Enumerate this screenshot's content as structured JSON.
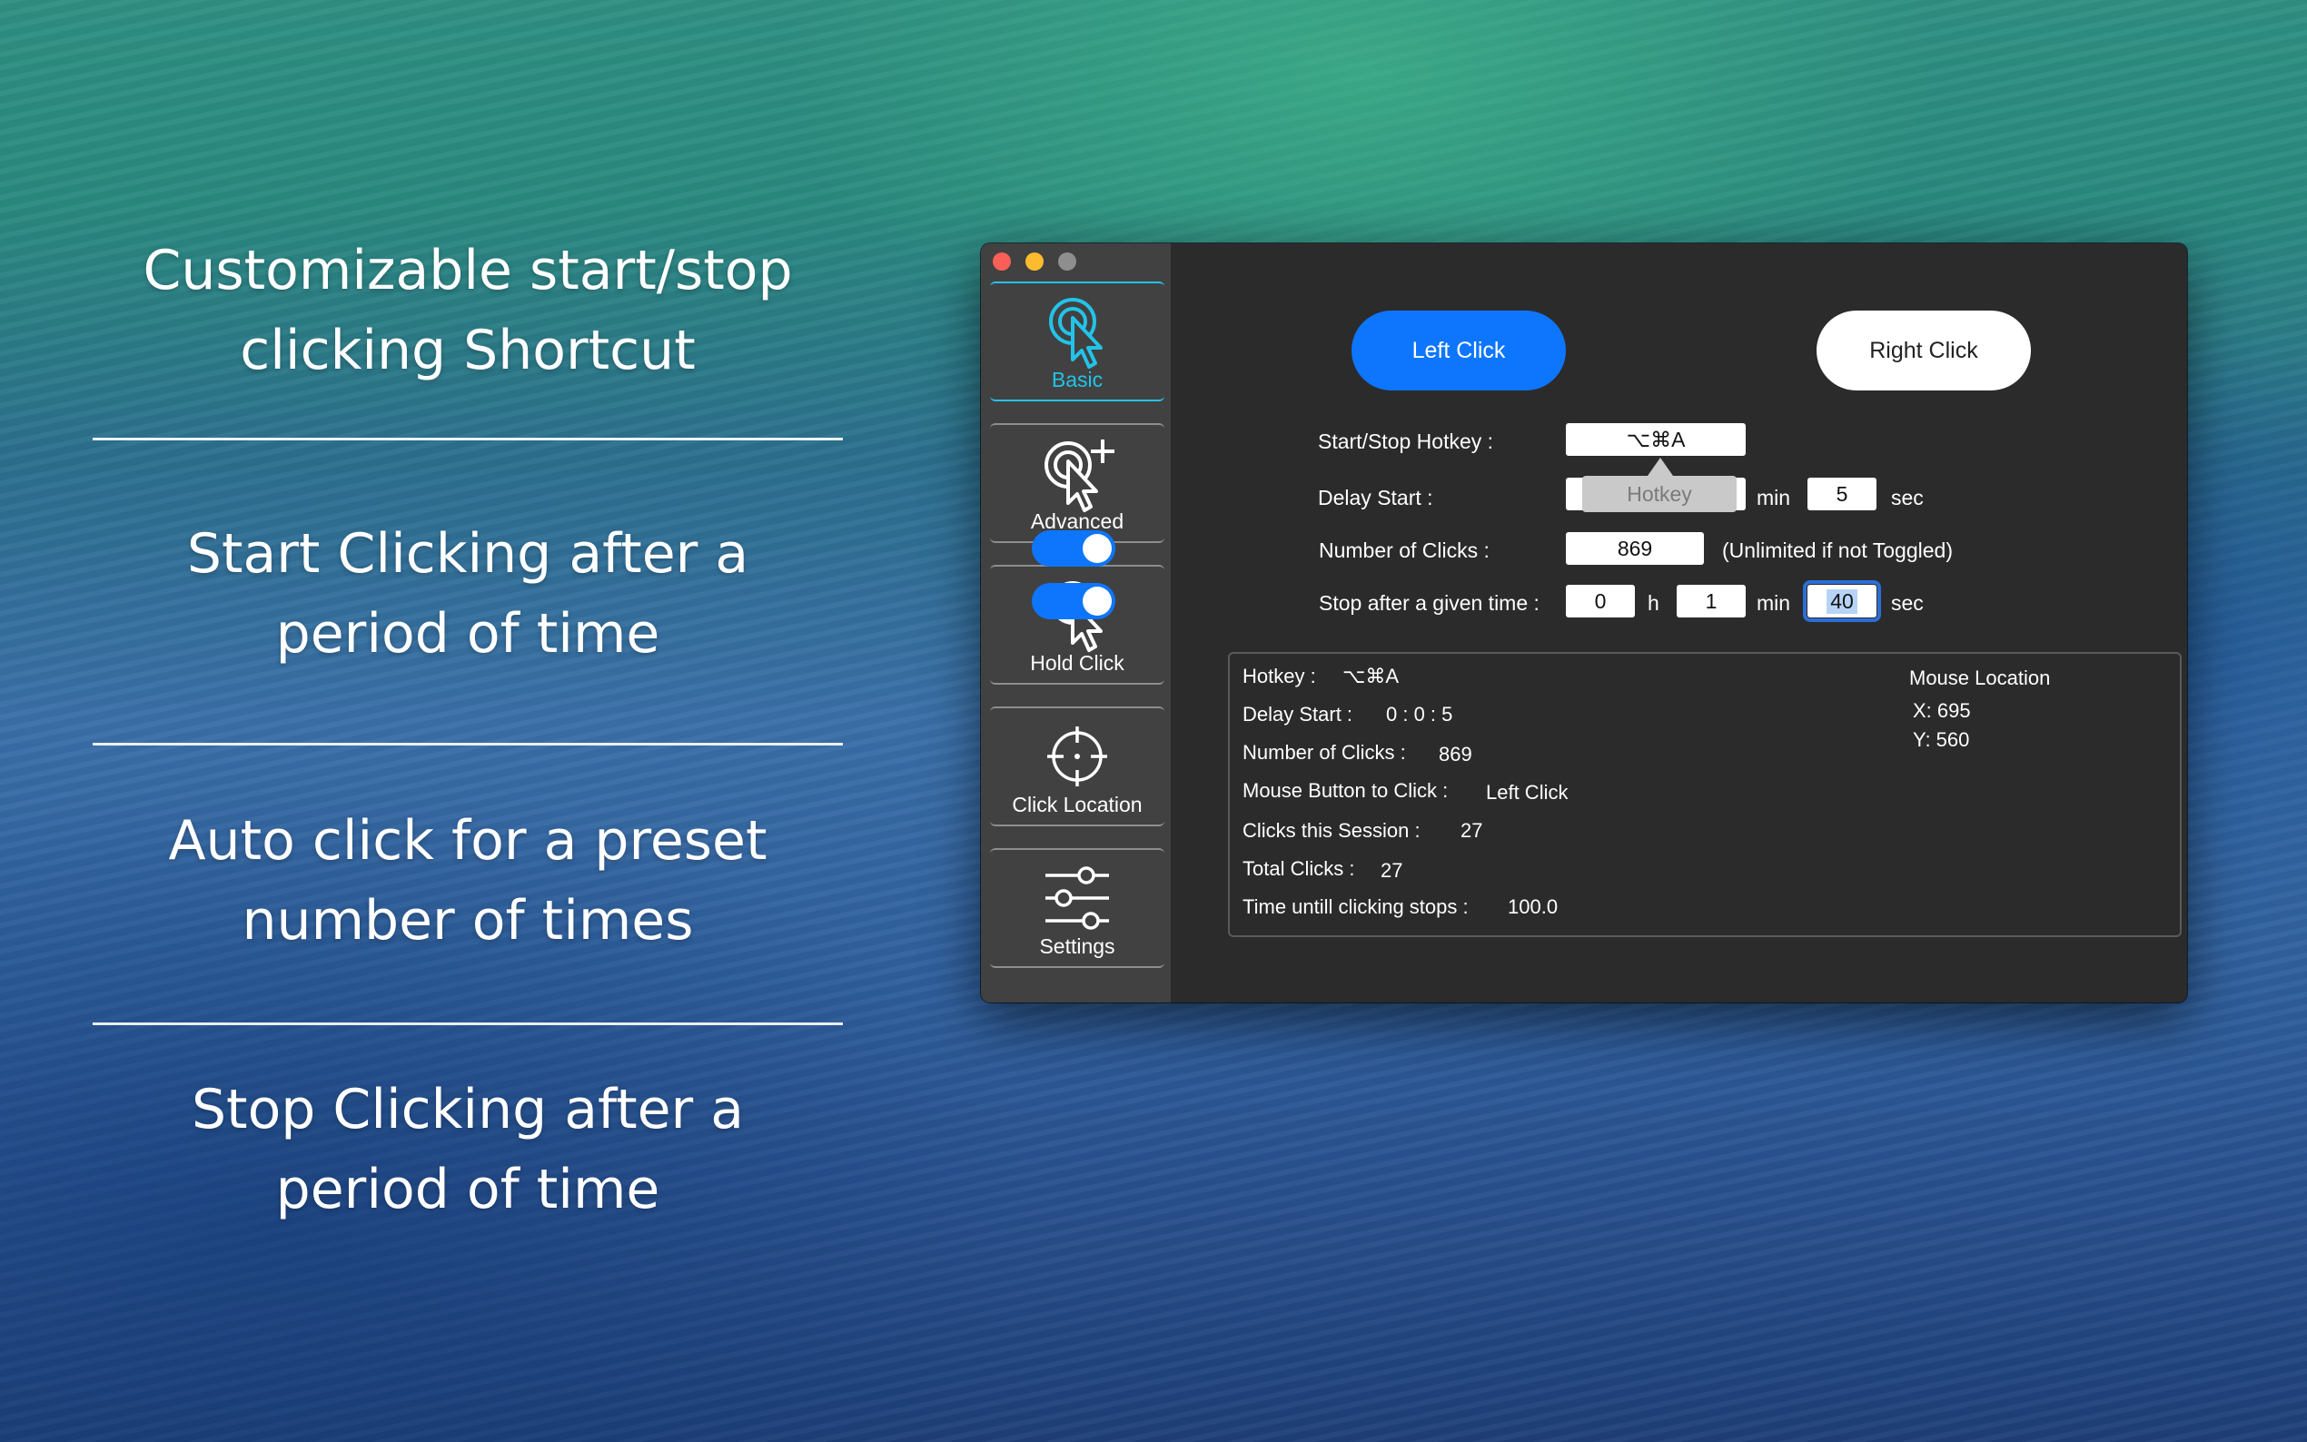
{
  "promo": {
    "feature1": [
      "Customizable start/stop",
      "clicking Shortcut"
    ],
    "feature2": [
      "Start Clicking after a",
      "period of time"
    ],
    "feature3": [
      "Auto click for a preset",
      "number of times"
    ],
    "feature4": [
      "Stop Clicking after a",
      "period of time"
    ]
  },
  "sidebar": {
    "items": [
      {
        "label": "Basic",
        "icon": "tap-pointer-icon"
      },
      {
        "label": "Advanced",
        "icon": "tap-pointer-plus-icon"
      },
      {
        "label": "Hold Click",
        "icon": "hold-pointer-icon"
      },
      {
        "label": "Click Location",
        "icon": "crosshair-icon"
      },
      {
        "label": "Settings",
        "icon": "sliders-icon"
      }
    ]
  },
  "buttons": {
    "left_click": "Left Click",
    "right_click": "Right Click"
  },
  "form": {
    "hotkey_label": "Start/Stop Hotkey :",
    "hotkey_value": "⌥⌘A",
    "hotkey_tooltip": "Hotkey",
    "delay_label": "Delay Start :",
    "delay_min_unit": "min",
    "delay_sec_value": "5",
    "delay_sec_unit": "sec",
    "clicks_label": "Number of Clicks :",
    "clicks_value": "869",
    "clicks_note": "(Unlimited if not Toggled)",
    "stop_label": "Stop after a given time :",
    "stop_h_value": "0",
    "stop_h_unit": "h",
    "stop_min_value": "1",
    "stop_min_unit": "min",
    "stop_sec_value": "40",
    "stop_sec_unit": "sec"
  },
  "info": {
    "hotkey_label": "Hotkey :",
    "hotkey_value": "⌥⌘A",
    "delay_label": "Delay Start :",
    "delay_value": "0 : 0 : 5",
    "clicks_label": "Number of Clicks :",
    "clicks_value": "869",
    "button_label": "Mouse Button to Click :",
    "button_value": "Left Click",
    "session_label": "Clicks this Session :",
    "session_value": "27",
    "total_label": "Total Clicks :",
    "total_value": "27",
    "time_label": "Time untill clicking stops :",
    "time_value": "100.0",
    "location_title": "Mouse Location",
    "x": "X: 695",
    "y": "Y: 560"
  },
  "colors": {
    "accent": "#0e76fd",
    "active_tab": "#23c3e8"
  }
}
